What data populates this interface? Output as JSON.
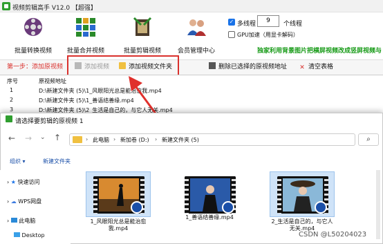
{
  "window": {
    "title": "视频剪辑高手 V12.0 【超强】"
  },
  "toolbar": {
    "items": [
      {
        "label": "批量转换视频",
        "icon": "film-reel-icon"
      },
      {
        "label": "批量合并视频",
        "icon": "grid-merge-icon"
      },
      {
        "label": "批量剪辑视频",
        "icon": "film-cut-icon"
      },
      {
        "label": "会员管理中心",
        "icon": "members-icon"
      }
    ],
    "multithread_label": "多线程",
    "multithread_checked": true,
    "thread_count": "9",
    "thread_unit": "个线程",
    "gpu_label": "GPU加速（用显卡解码）",
    "gpu_checked": false,
    "notice": "独家利用背景图片把横屏视频改成竖屏视频与"
  },
  "step": {
    "label": "第一步：添加原视频",
    "add_video": "添加视频",
    "add_folder": "添加视频文件夹",
    "delete_selected": "删除已选择的原视频地址",
    "clear_table": "清空表格"
  },
  "table": {
    "headers": [
      "序号",
      "原视频地址"
    ],
    "rows": [
      {
        "no": "1",
        "path": "D:\\新建文件夹 (5)\\1_风眼阳光总是能治愈我.mp4"
      },
      {
        "no": "2",
        "path": "D:\\新建文件夹 (5)\\1_善语结善缘.mp4"
      },
      {
        "no": "3",
        "path": "D:\\新建文件夹 (5)\\2_生活是自己的，与它人无关.mp4"
      }
    ]
  },
  "dialog": {
    "title": "请选择要剪辑的原视频 1",
    "breadcrumb": [
      "此电脑",
      "新加卷 (D:)",
      "新建文件夹 (5)"
    ],
    "organize": "组织 ▾",
    "new_folder": "新建文件夹",
    "nav": [
      "快速访问",
      "WPS网盘",
      "此电脑",
      "Desktop"
    ],
    "files": [
      {
        "name": "1_风眼阳光总是能治愈我.mp4"
      },
      {
        "name": "1_善语结善缘.mp4"
      },
      {
        "name": "2_生活是自己的，与它人无关.mp4"
      }
    ]
  },
  "watermark": "CSDN @L50204023",
  "colors": {
    "accent_red": "#d9302c",
    "notice_green": "#169a16",
    "selection_blue": "#cfe3f8"
  }
}
